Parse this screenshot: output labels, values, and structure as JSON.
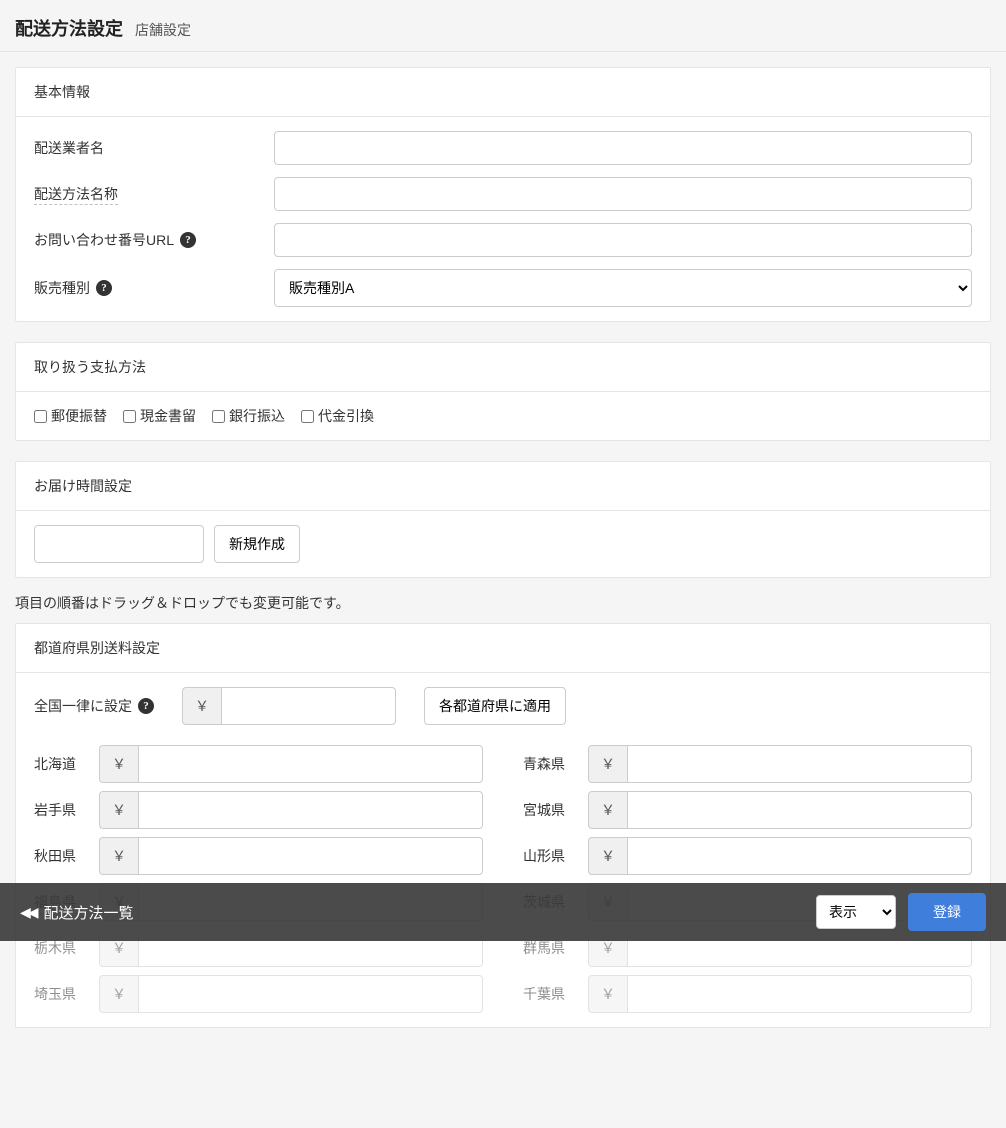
{
  "header": {
    "title": "配送方法設定",
    "subtitle": "店舗設定"
  },
  "sections": {
    "basic_title": "基本情報",
    "payment_title": "取り扱う支払方法",
    "time_title": "お届け時間設定",
    "pref_title": "都道府県別送料設定"
  },
  "basic": {
    "carrier_label": "配送業者名",
    "carrier_value": "",
    "method_label": "配送方法名称",
    "method_value": "",
    "inquiry_label": "お問い合わせ番号URL",
    "inquiry_value": "",
    "sale_type_label": "販売種別",
    "sale_type_selected": "販売種別A"
  },
  "payments": [
    {
      "label": "郵便振替",
      "checked": false
    },
    {
      "label": "現金書留",
      "checked": false
    },
    {
      "label": "銀行振込",
      "checked": false
    },
    {
      "label": "代金引換",
      "checked": false
    }
  ],
  "time": {
    "new_button": "新規作成",
    "input_value": "",
    "drag_note": "項目の順番はドラッグ＆ドロップでも変更可能です。"
  },
  "pref": {
    "uniform_label": "全国一律に設定",
    "uniform_value": "",
    "yen_symbol": "￥",
    "apply_button": "各都道府県に適用",
    "items": [
      {
        "name": "北海道",
        "value": ""
      },
      {
        "name": "青森県",
        "value": ""
      },
      {
        "name": "岩手県",
        "value": ""
      },
      {
        "name": "宮城県",
        "value": ""
      },
      {
        "name": "秋田県",
        "value": ""
      },
      {
        "name": "山形県",
        "value": ""
      },
      {
        "name": "福島県",
        "value": ""
      },
      {
        "name": "茨城県",
        "value": ""
      },
      {
        "name": "栃木県",
        "value": ""
      },
      {
        "name": "群馬県",
        "value": ""
      },
      {
        "name": "埼玉県",
        "value": ""
      },
      {
        "name": "千葉県",
        "value": ""
      }
    ]
  },
  "footer": {
    "back_label": "配送方法一覧",
    "visibility_selected": "表示",
    "submit_label": "登録"
  }
}
